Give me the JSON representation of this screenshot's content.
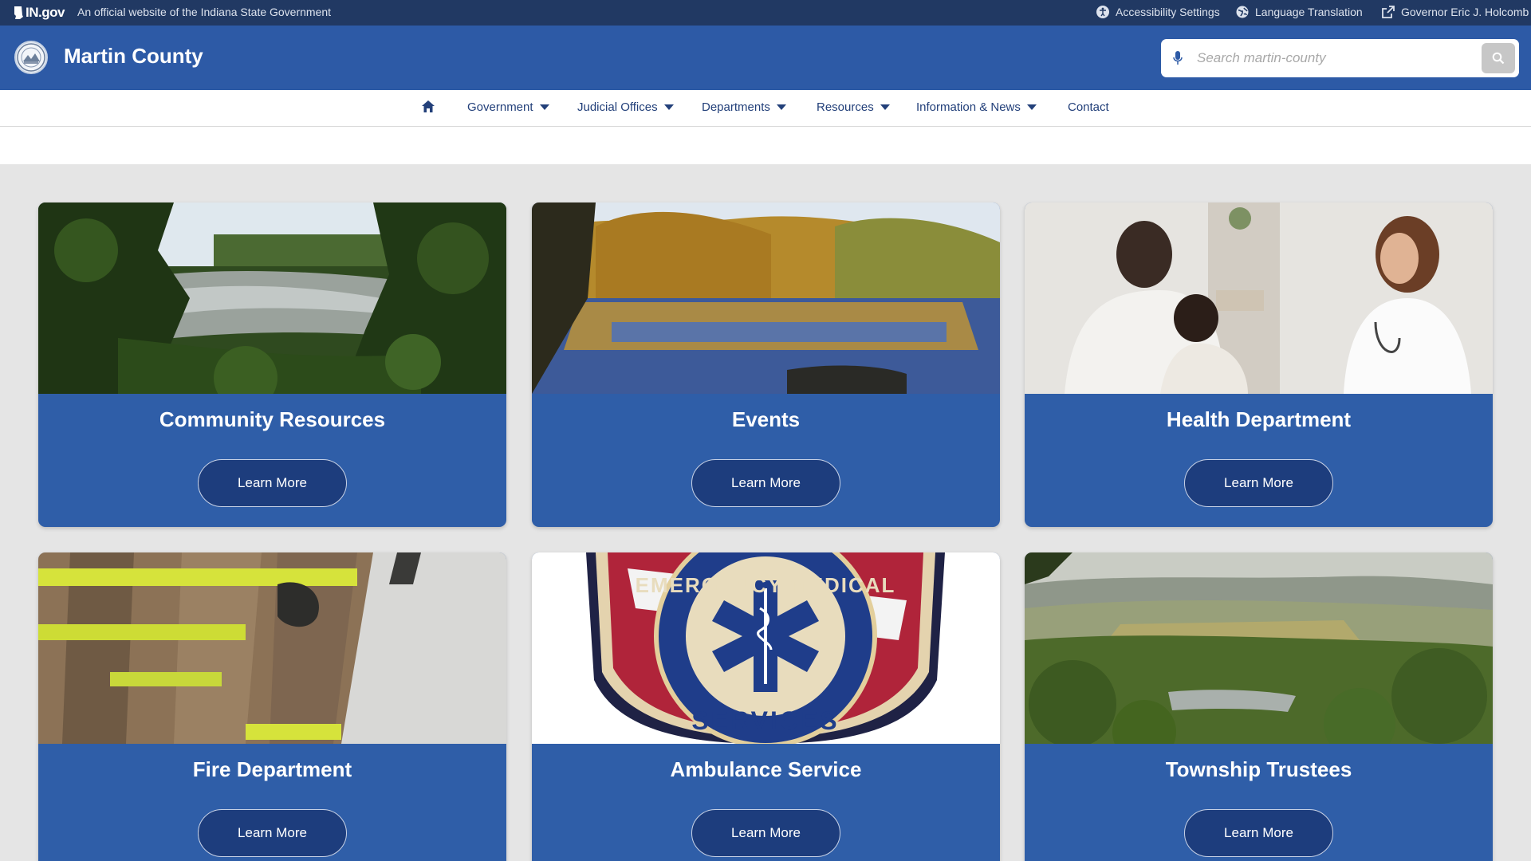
{
  "topbar": {
    "brand": "IN.gov",
    "official_text": "An official website of the Indiana State Government",
    "links": [
      {
        "label": "Accessibility Settings",
        "icon": "accessibility-icon"
      },
      {
        "label": "Language Translation",
        "icon": "globe-icon"
      },
      {
        "label": "Governor Eric J. Holcomb",
        "icon": "external-link-icon"
      }
    ]
  },
  "header": {
    "title": "Martin County",
    "search_placeholder": "Search martin-county",
    "icons": {
      "seal": "county-seal-logo",
      "mic": "microphone-icon",
      "search": "search-icon"
    }
  },
  "nav": {
    "home_icon": "home-icon",
    "items": [
      {
        "label": "Government",
        "dropdown": true
      },
      {
        "label": "Judicial Offices",
        "dropdown": true
      },
      {
        "label": "Departments",
        "dropdown": true
      },
      {
        "label": "Resources",
        "dropdown": true
      },
      {
        "label": "Information & News",
        "dropdown": true
      },
      {
        "label": "Contact",
        "dropdown": false
      }
    ]
  },
  "cards": [
    {
      "title": "Community Resources",
      "button": "Learn More",
      "image": "river through trees"
    },
    {
      "title": "Events",
      "button": "Learn More",
      "image": "autumn lake reflection"
    },
    {
      "title": "Health Department",
      "button": "Learn More",
      "image": "doctor with parent and child"
    },
    {
      "title": "Fire Department",
      "button": "Learn More",
      "image": "firefighter gear"
    },
    {
      "title": "Ambulance Service",
      "button": "Learn More",
      "image": "emergency medical services patch"
    },
    {
      "title": "Township Trustees",
      "button": "Learn More",
      "image": "wooded valley landscape"
    }
  ],
  "patch_text": {
    "top": "EMERGENCY MEDICAL",
    "bottom": "SERVICES"
  },
  "colors": {
    "topbar": "#213963",
    "header": "#2d5aa6",
    "card": "#2f5ea8",
    "button": "#1d3d7d",
    "nav_text": "#23407a",
    "page_bg": "#e5e5e5"
  }
}
